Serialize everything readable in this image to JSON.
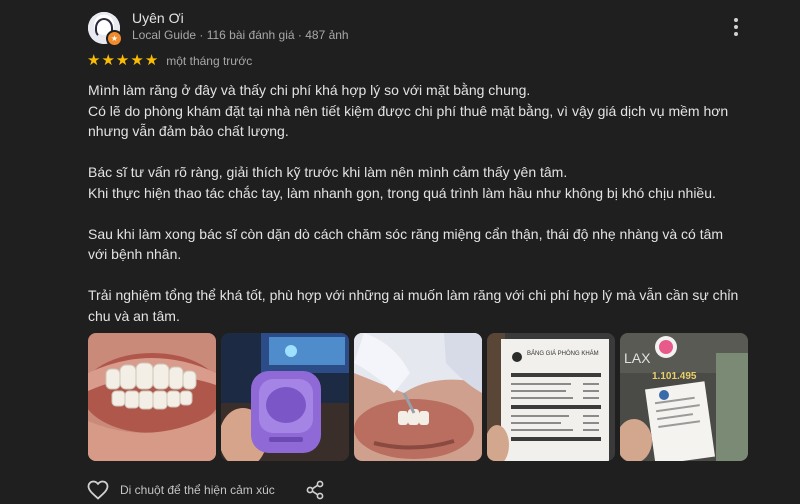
{
  "author": {
    "name": "Uyên Ơi",
    "meta": "Local Guide · 116 bài đánh giá · 487 ảnh"
  },
  "review": {
    "rating": 5,
    "max_rating": 5,
    "time": "một tháng trước",
    "paragraphs": [
      [
        "Mình làm răng ở đây và thấy chi phí khá hợp lý so với mặt bằng chung.",
        "Có lẽ do phòng khám đặt tại nhà nên tiết kiệm được chi phí thuê mặt bằng, vì vậy giá dịch vụ mềm hơn",
        "nhưng vẫn đảm bảo chất lượng."
      ],
      [
        "Bác sĩ tư vấn rõ ràng, giải thích kỹ trước khi làm nên mình cảm thấy yên tâm.",
        "Khi thực hiện thao tác chắc tay, làm nhanh gọn, trong quá trình làm hầu như không bị khó chịu nhiều."
      ],
      [
        "Sau khi làm xong bác sĩ còn dặn dò cách chăm sóc răng miệng cẩn thận, thái độ nhẹ nhàng và có tâm",
        "với bệnh nhân."
      ],
      [
        "Trải nghiệm tổng thể khá tốt, phù hợp với những ai muốn làm răng với chi phí hợp lý mà vẫn cần sự chỉn",
        "chu và an tâm."
      ]
    ]
  },
  "photos": {
    "price_sheet_title": "BẢNG GIÁ PHÒNG KHÁM",
    "signage_text": "LAX",
    "phone_text": "1.101.495"
  },
  "actions": {
    "like_label": "Di chuột để thể hiện cảm xúc"
  },
  "colors": {
    "background": "#1f1f1f",
    "star": "#fbbc04",
    "text": "#e3e3e3",
    "muted": "#a8a8a8"
  }
}
